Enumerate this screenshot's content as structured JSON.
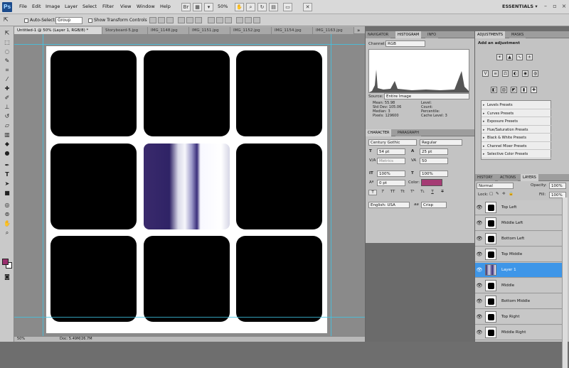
{
  "menubar": {
    "logo": "Ps",
    "items": [
      "File",
      "Edit",
      "Image",
      "Layer",
      "Select",
      "Filter",
      "View",
      "Window",
      "Help"
    ],
    "zoom": "50%",
    "workspace": "ESSENTIALS ▾"
  },
  "options": {
    "auto_select_label": "Auto-Select:",
    "group_value": "Group",
    "transform_label": "Show Transform Controls"
  },
  "tabs": [
    "Untitled-1 @ 50% (Layer 1, RGB/8) *",
    "Storyboard-5.jpg",
    "IMG_1148.jpg",
    "IMG_1151.jpg",
    "IMG_1152.jpg",
    "IMG_1154.jpg",
    "IMG_1163.jpg"
  ],
  "status": {
    "zoom": "50%",
    "doc": "Doc: 5.49M/26.7M"
  },
  "histogram_panel": {
    "tabs": [
      "NAVIGATOR",
      "HISTOGRAM",
      "INFO"
    ],
    "channel_label": "Channel:",
    "channel_value": "RGB",
    "source_label": "Source:",
    "source_value": "Entire Image",
    "stats_left": [
      [
        "Mean:",
        "55.98"
      ],
      [
        "Std Dev:",
        "105.06"
      ],
      [
        "Median:",
        "3"
      ],
      [
        "Pixels:",
        "129600"
      ]
    ],
    "stats_right": [
      "Level:",
      "Count:",
      "Percentile:",
      "Cache Level:  3"
    ]
  },
  "character_panel": {
    "tabs": [
      "CHARACTER",
      "PARAGRAPH"
    ],
    "font": "Century Gothic",
    "style": "Regular",
    "size": "54 pt",
    "leading": "25 pt",
    "kerning": "Metrics",
    "tracking": "50",
    "vscale": "100%",
    "hscale": "100%",
    "baseline": "0 pt",
    "color_label": "Color:",
    "text_color": "#a53b74",
    "style_buttons": [
      "T",
      "T",
      "TT",
      "Tt",
      "T¹",
      "T₁",
      "T",
      "T"
    ],
    "language": "English: USA",
    "aa_label": "aa",
    "aa_value": "Crisp"
  },
  "adjustments": {
    "tabs": [
      "ADJUSTMENTS",
      "MASKS"
    ],
    "heading": "Add an adjustment",
    "icons_row1": [
      "brightness-contrast-icon",
      "levels-icon",
      "curves-icon",
      "exposure-icon"
    ],
    "icons_row2": [
      "vibrance-icon",
      "hue-saturation-icon",
      "color-balance-icon",
      "black-white-icon",
      "photo-filter-icon",
      "channel-mixer-icon"
    ],
    "icons_row3": [
      "invert-icon",
      "posterize-icon",
      "threshold-icon",
      "gradient-map-icon",
      "selective-color-icon"
    ],
    "presets": [
      "Levels Presets",
      "Curves Presets",
      "Exposure Presets",
      "Hue/Saturation Presets",
      "Black & White Presets",
      "Channel Mixer Presets",
      "Selective Color Presets"
    ]
  },
  "layers_panel": {
    "tabs": [
      "HISTORY",
      "ACTIONS",
      "LAYERS"
    ],
    "blend": "Normal",
    "opacity_label": "Opacity:",
    "opacity": "100%",
    "lock_label": "Lock:",
    "fill_label": "Fill:",
    "fill": "100%",
    "layers": [
      {
        "name": "Top Left",
        "selected": false
      },
      {
        "name": "Middle Left",
        "selected": false
      },
      {
        "name": "Bottom Left",
        "selected": false
      },
      {
        "name": "Top Middle",
        "selected": false
      },
      {
        "name": "Layer 1",
        "selected": true
      },
      {
        "name": "Middle",
        "selected": false
      },
      {
        "name": "Bottom Middle",
        "selected": false
      },
      {
        "name": "Top Right",
        "selected": false
      },
      {
        "name": "Middle Right",
        "selected": false
      }
    ]
  }
}
